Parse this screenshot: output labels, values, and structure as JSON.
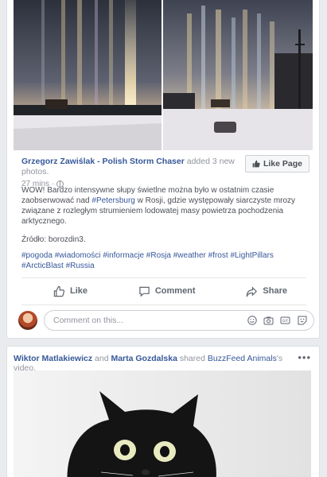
{
  "post": {
    "author": "Grzegorz Zawiślak - Polish Storm Chaser",
    "action_text": " added 3 new photos.",
    "time": "27 mins",
    "time_sep": " · ",
    "like_page_label": "Like Page",
    "text_p1_a": "WOW! Bardzo intensywne słupy świetlne można było w ostatnim czasie zaobserwować nad ",
    "text_p1_link": "#Petersburg",
    "text_p1_b": " w Rosji, gdzie występowały siarczyste mrozy związane z rozległym strumieniem lodowatej masy powietrza pochodzenia arktycznego.",
    "source": "Źródło: borozdin3.",
    "hashtags": [
      "#pogoda",
      "#wiadomości",
      "#informacje",
      "#Rosja",
      "#weather",
      "#frost",
      "#LightPillars",
      "#ArcticBlast",
      "#Russia"
    ],
    "actions": {
      "like": "Like",
      "comment": "Comment",
      "share": "Share"
    },
    "comment_placeholder": "Comment on this...",
    "comment_icons": [
      "emoji-icon",
      "camera-icon",
      "gif-icon",
      "sticker-icon"
    ]
  },
  "post2": {
    "user1": "Wiktor Matlakiewicz",
    "and": " and ",
    "user2": "Marta Gozdalska",
    "shared_text": " shared ",
    "page": "BuzzFeed Animals",
    "tail": "'s video.",
    "more": "•••"
  },
  "colors": {
    "link": "#365899",
    "muted": "#90949c",
    "background": "#e9ebee"
  }
}
